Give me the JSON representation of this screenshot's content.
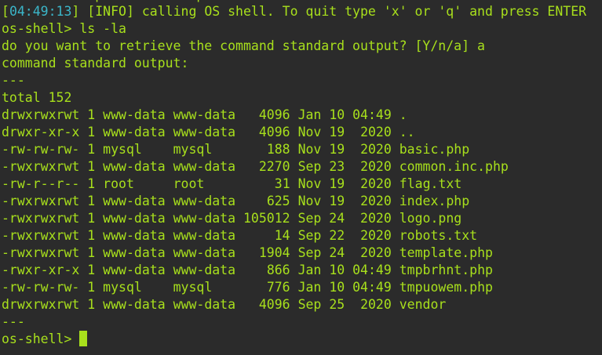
{
  "terminal": {
    "clipped_fragment": "            p            p",
    "log": {
      "bracket_open": "[",
      "timestamp": "04:49:13",
      "bracket_close": "]",
      "level_open": " [",
      "level": "INFO",
      "level_close": "]",
      "message": " calling OS shell. To quit type 'x' or 'q' and press ENTER"
    },
    "command_line": "os-shell> ls -la",
    "question": "do you want to retrieve the command standard output? [Y/n/a] a",
    "output_header": "command standard output:",
    "separator_top": "---",
    "total": "total 152",
    "listing": [
      {
        "perms": "drwxrwxrwt",
        "links": "1",
        "owner": "www-data",
        "group": "www-data",
        "size": "4096",
        "month": "Jan",
        "day": "10",
        "time": "04:49",
        "name": "."
      },
      {
        "perms": "drwxr-xr-x",
        "links": "1",
        "owner": "www-data",
        "group": "www-data",
        "size": "4096",
        "month": "Nov",
        "day": "19",
        "time": "2020",
        "name": ".."
      },
      {
        "perms": "-rw-rw-rw-",
        "links": "1",
        "owner": "mysql",
        "group": "mysql",
        "size": "188",
        "month": "Nov",
        "day": "19",
        "time": "2020",
        "name": "basic.php"
      },
      {
        "perms": "-rwxrwxrwt",
        "links": "1",
        "owner": "www-data",
        "group": "www-data",
        "size": "2270",
        "month": "Sep",
        "day": "23",
        "time": "2020",
        "name": "common.inc.php"
      },
      {
        "perms": "-rw-r--r--",
        "links": "1",
        "owner": "root",
        "group": "root",
        "size": "31",
        "month": "Nov",
        "day": "19",
        "time": "2020",
        "name": "flag.txt"
      },
      {
        "perms": "-rwxrwxrwt",
        "links": "1",
        "owner": "www-data",
        "group": "www-data",
        "size": "625",
        "month": "Nov",
        "day": "19",
        "time": "2020",
        "name": "index.php"
      },
      {
        "perms": "-rwxrwxrwt",
        "links": "1",
        "owner": "www-data",
        "group": "www-data",
        "size": "105012",
        "month": "Sep",
        "day": "24",
        "time": "2020",
        "name": "logo.png"
      },
      {
        "perms": "-rwxrwxrwt",
        "links": "1",
        "owner": "www-data",
        "group": "www-data",
        "size": "14",
        "month": "Sep",
        "day": "22",
        "time": "2020",
        "name": "robots.txt"
      },
      {
        "perms": "-rwxrwxrwt",
        "links": "1",
        "owner": "www-data",
        "group": "www-data",
        "size": "1904",
        "month": "Sep",
        "day": "24",
        "time": "2020",
        "name": "template.php"
      },
      {
        "perms": "-rwxr-xr-x",
        "links": "1",
        "owner": "www-data",
        "group": "www-data",
        "size": "866",
        "month": "Jan",
        "day": "10",
        "time": "04:49",
        "name": "tmpbrhnt.php"
      },
      {
        "perms": "-rw-rw-rw-",
        "links": "1",
        "owner": "mysql",
        "group": "mysql",
        "size": "776",
        "month": "Jan",
        "day": "10",
        "time": "04:49",
        "name": "tmpuowem.php"
      },
      {
        "perms": "drwxrwxrwt",
        "links": "1",
        "owner": "www-data",
        "group": "www-data",
        "size": "4096",
        "month": "Sep",
        "day": "25",
        "time": "2020",
        "name": "vendor"
      }
    ],
    "separator_bottom": "---",
    "prompt": "os-shell> "
  },
  "colors": {
    "background": "#2b2b2b",
    "text": "#a8e01c",
    "timestamp": "#3bb6c9"
  }
}
